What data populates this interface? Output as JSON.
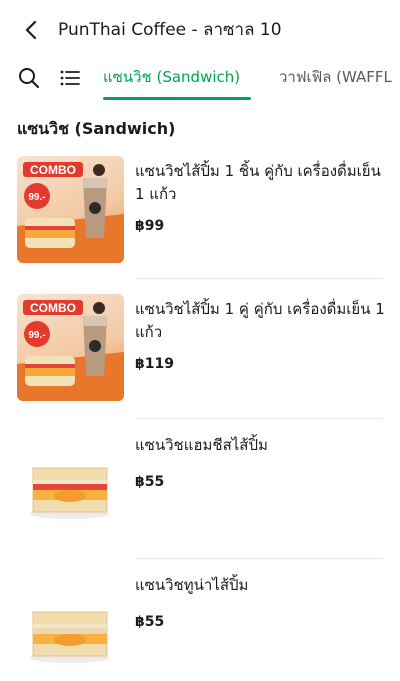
{
  "header": {
    "title": "PunThai Coffee - ลาซาล 10"
  },
  "tabs": [
    {
      "label": "แซนวิช (Sandwich)",
      "active": true
    },
    {
      "label": "วาฟเฟิล (WAFFL",
      "active": false
    }
  ],
  "section": {
    "title": "แซนวิช (Sandwich)"
  },
  "items": [
    {
      "name": "แซนวิชไส้ปิ้ม 1 ชิ้น คู่กับ เครื่องดื่มเย็น 1 แก้ว",
      "price": "฿99",
      "image": {
        "type": "combo",
        "badge": "COMBO",
        "price_tag": "99.-"
      }
    },
    {
      "name": "แซนวิชไส้ปิ้ม 1 คู่ คู่กับ เครื่องดื่มเย็น 1 แก้ว",
      "price": "฿119",
      "image": {
        "type": "combo",
        "badge": "COMBO",
        "price_tag": "99.-"
      }
    },
    {
      "name": "แซนวิชแฮมชีสไส้ปิ้ม",
      "price": "฿55",
      "image": {
        "type": "sandwich"
      }
    },
    {
      "name": "แซนวิชทูน่าไส้ปิ้ม",
      "price": "฿55",
      "image": {
        "type": "sandwich"
      }
    }
  ],
  "colors": {
    "accent": "#00a453",
    "text": "#1c1c1c",
    "muted": "#5b5b5b",
    "combo_orange": "#e8762b",
    "combo_red": "#e23b2e"
  },
  "icons": {
    "back": "chevron-left-icon",
    "search": "search-icon",
    "list": "list-icon"
  }
}
